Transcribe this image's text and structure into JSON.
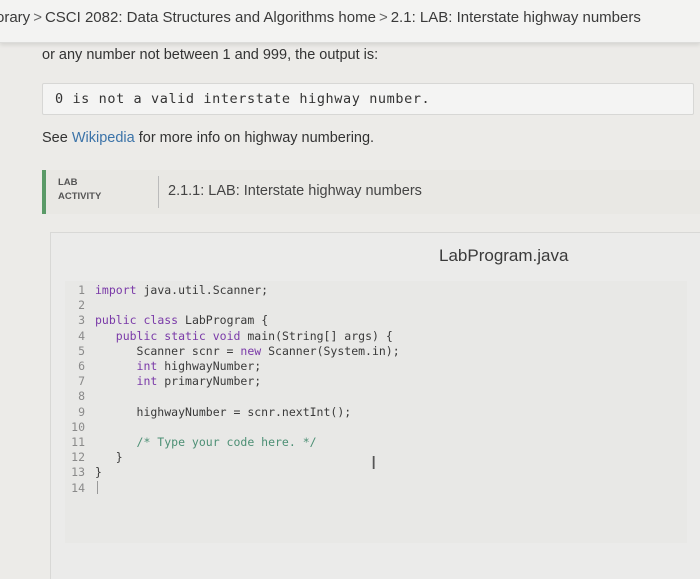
{
  "breadcrumb": {
    "library": "orary",
    "course": "CSCI 2082: Data Structures and Algorithms home",
    "section": "2.1: LAB: Interstate highway numbers",
    "separator": ">"
  },
  "description": "or any number not between 1 and 999, the output is:",
  "output_example": "0 is not a valid interstate highway number.",
  "see_line": {
    "prefix": "See",
    "link": "Wikipedia",
    "suffix": "for more info on highway numbering."
  },
  "activity": {
    "label_line1": "LAB",
    "label_line2": "ACTIVITY",
    "title": "2.1.1: LAB: Interstate highway numbers"
  },
  "editor": {
    "filename": "LabProgram.java",
    "lines": [
      {
        "n": "1",
        "text": "import java.util.Scanner;"
      },
      {
        "n": "2",
        "text": ""
      },
      {
        "n": "3",
        "text": "public class LabProgram {"
      },
      {
        "n": "4",
        "text": "   public static void main(String[] args) {"
      },
      {
        "n": "5",
        "text": "      Scanner scnr = new Scanner(System.in);"
      },
      {
        "n": "6",
        "text": "      int highwayNumber;"
      },
      {
        "n": "7",
        "text": "      int primaryNumber;"
      },
      {
        "n": "8",
        "text": ""
      },
      {
        "n": "9",
        "text": "      highwayNumber = scnr.nextInt();"
      },
      {
        "n": "10",
        "text": ""
      },
      {
        "n": "11",
        "text": "      /* Type your code here. */"
      },
      {
        "n": "12",
        "text": "   }"
      },
      {
        "n": "13",
        "text": "}"
      },
      {
        "n": "14",
        "text": ""
      }
    ]
  },
  "colors": {
    "accent_green": "#5a9a67",
    "link_blue": "#3b73a8",
    "keyword_purple": "#7a3aa8",
    "comment_green": "#4c8f74"
  }
}
